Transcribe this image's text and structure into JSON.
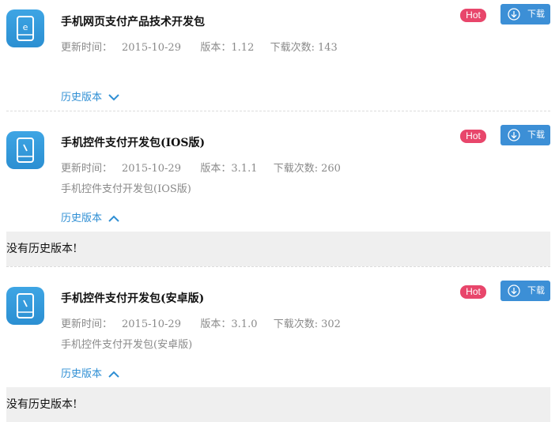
{
  "items": [
    {
      "title": "手机网页支付产品技术开发包",
      "updated_label": "更新时间：",
      "updated": "2015-10-29",
      "version_label": "版本：",
      "version": "1.12",
      "downloads_label": "下载次数:",
      "downloads": "143",
      "description": "",
      "history": "历史版本",
      "hot": "Hot",
      "download": "下载",
      "icon": "web-phone-icon",
      "history_expanded": false
    },
    {
      "title": "手机控件支付开发包(IOS版)",
      "updated_label": "更新时间：",
      "updated": "2015-10-29",
      "version_label": "版本：",
      "version": "3.1.1",
      "downloads_label": "下载次数:",
      "downloads": "260",
      "description": "手机控件支付开发包(IOS版)",
      "history": "历史版本",
      "hot": "Hot",
      "download": "下载",
      "icon": "phone-icon",
      "history_expanded": true,
      "no_history": "没有历史版本!"
    },
    {
      "title": "手机控件支付开发包(安卓版)",
      "updated_label": "更新时间：",
      "updated": "2015-10-29",
      "version_label": "版本：",
      "version": "3.1.0",
      "downloads_label": "下载次数:",
      "downloads": "302",
      "description": "手机控件支付开发包(安卓版)",
      "history": "历史版本",
      "hot": "Hot",
      "download": "下载",
      "icon": "phone-icon",
      "history_expanded": true,
      "no_history": "没有历史版本!"
    }
  ],
  "colors": {
    "accent": "#3c8fd6",
    "hot_badge": "#e8466b",
    "link": "#2f8fd4",
    "meta_text": "#8a8a8a",
    "panel_bg": "#efefef"
  }
}
